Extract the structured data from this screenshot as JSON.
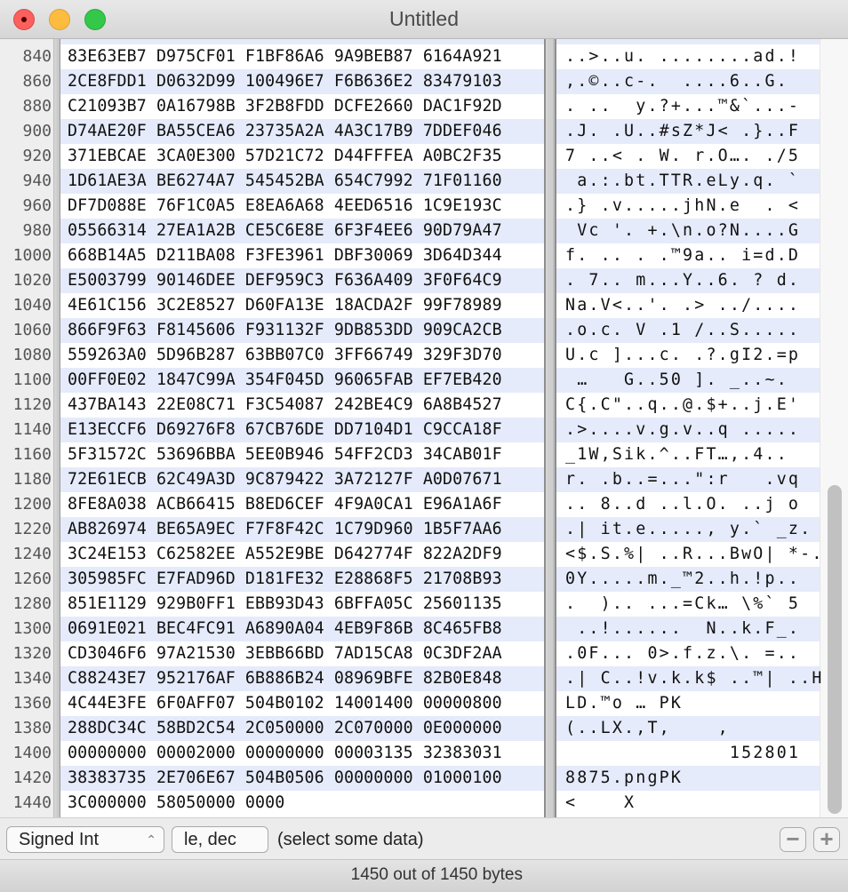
{
  "window": {
    "title": "Untitled"
  },
  "editor": {
    "partial_top_ascii": "y",
    "rows": [
      {
        "offset": "840",
        "hex": "83E63EB7 D975CF01 F1BF86A6 9A9BEB87 6164A921",
        "ascii": "..>..u. ........ad.!"
      },
      {
        "offset": "860",
        "hex": "2CE8FDD1 D0632D99 100496E7 F6B636E2 83479103",
        "ascii": ",.©..c-.  ....6..G."
      },
      {
        "offset": "880",
        "hex": "C21093B7 0A16798B 3F2B8FDD DCFE2660 DAC1F92D",
        "ascii": ". ..  y.?+...™&`...-"
      },
      {
        "offset": "900",
        "hex": "D74AE20F BA55CEA6 23735A2A 4A3C17B9 7DDEF046",
        "ascii": ".J. .U..#sZ*J< .}..F"
      },
      {
        "offset": "920",
        "hex": "371EBCAE 3CA0E300 57D21C72 D44FFFEA A0BC2F35",
        "ascii": "7 ..< . W. r.O…. ./5"
      },
      {
        "offset": "940",
        "hex": "1D61AE3A BE6274A7 545452BA 654C7992 71F01160",
        "ascii": " a.:.bt.TTR.eLy.q. `"
      },
      {
        "offset": "960",
        "hex": "DF7D088E 76F1C0A5 E8EA6A68 4EED6516 1C9E193C",
        "ascii": ".} .v.....jhN.e  . <"
      },
      {
        "offset": "980",
        "hex": "05566314 27EA1A2B CE5C6E8E 6F3F4EE6 90D79A47",
        "ascii": " Vc '. +.\\n.o?N....G"
      },
      {
        "offset": "1000",
        "hex": "668B14A5 D211BA08 F3FE3961 DBF30069 3D64D344",
        "ascii": "f. .. . .™9a.. i=d.D"
      },
      {
        "offset": "1020",
        "hex": "E5003799 90146DEE DEF959C3 F636A409 3F0F64C9",
        "ascii": ". 7.. m...Y..6. ? d."
      },
      {
        "offset": "1040",
        "hex": "4E61C156 3C2E8527 D60FA13E 18ACDA2F 99F78989",
        "ascii": "Na.V<..'. .> ../...."
      },
      {
        "offset": "1060",
        "hex": "866F9F63 F8145606 F931132F 9DB853DD 909CA2CB",
        "ascii": ".o.c. V .1 /..S....."
      },
      {
        "offset": "1080",
        "hex": "559263A0 5D96B287 63BB07C0 3FF66749 329F3D70",
        "ascii": "U.c ]...c. .?.gI2.=p"
      },
      {
        "offset": "1100",
        "hex": "00FF0E02 1847C99A 354F045D 96065FAB EF7EB420",
        "ascii": " …   G..50 ]. _..~."
      },
      {
        "offset": "1120",
        "hex": "437BA143 22E08C71 F3C54087 242BE4C9 6A8B4527",
        "ascii": "C{.C\"..q..@.$+..j.E'"
      },
      {
        "offset": "1140",
        "hex": "E13ECCF6 D69276F8 67CB76DE DD7104D1 C9CCA18F",
        "ascii": ".>....v.g.v..q ....."
      },
      {
        "offset": "1160",
        "hex": "5F31572C 53696BBA 5EE0B946 54FF2CD3 34CAB01F",
        "ascii": "_1W,Sik.^..FT…,.4.."
      },
      {
        "offset": "1180",
        "hex": "72E61ECB 62C49A3D 9C879422 3A72127F A0D07671",
        "ascii": "r. .b..=...\":r   .vq"
      },
      {
        "offset": "1200",
        "hex": "8FE8A038 ACB66415 B8ED6CEF 4F9A0CA1 E96A1A6F",
        "ascii": ".. 8..d ..l.O. ..j o"
      },
      {
        "offset": "1220",
        "hex": "AB826974 BE65A9EC F7F8F42C 1C79D960 1B5F7AA6",
        "ascii": ".| it.e....., y.` _z."
      },
      {
        "offset": "1240",
        "hex": "3C24E153 C62582EE A552E9BE D642774F 822A2DF9",
        "ascii": "<$.S.%| ..R...BwO| *-."
      },
      {
        "offset": "1260",
        "hex": "305985FC E7FAD96D D181FE32 E28868F5 21708B93",
        "ascii": "0Y.....m._™2..h.!p.."
      },
      {
        "offset": "1280",
        "hex": "851E1129 929B0FF1 EBB93D43 6BFFA05C 25601135",
        "ascii": ".  ).. ...=Ck… \\%` 5"
      },
      {
        "offset": "1300",
        "hex": "0691E021 BEC4FC91 A6890A04 4EB9F86B 8C465FB8",
        "ascii": " ..!......  N..k.F_."
      },
      {
        "offset": "1320",
        "hex": "CD3046F6 97A21530 3EBB66BD 7AD15CA8 0C3DF2AA",
        "ascii": ".0F... 0>.f.z.\\. =.."
      },
      {
        "offset": "1340",
        "hex": "C88243E7 952176AF 6B886B24 08969BFE 82B0E848",
        "ascii": ".| C..!v.k.k$ ..™| ..H"
      },
      {
        "offset": "1360",
        "hex": "4C44E3FE 6F0AFF07 504B0102 14001400 00000800",
        "ascii": "LD.™o … PK"
      },
      {
        "offset": "1380",
        "hex": "288DC34C 58BD2C54 2C050000 2C070000 0E000000",
        "ascii": "(..LX.,T,    ,"
      },
      {
        "offset": "1400",
        "hex": "00000000 00002000 00000000 00003135 32383031",
        "ascii": "              152801"
      },
      {
        "offset": "1420",
        "hex": "38383735 2E706E67 504B0506 00000000 01000100",
        "ascii": "8875.pngPK"
      },
      {
        "offset": "1440",
        "hex": "3C000000 58050000 0000",
        "ascii": "<    X"
      }
    ],
    "scroll_position": 1.0
  },
  "footer": {
    "type_select": {
      "value": "Signed Int",
      "icon": "up-down-chevron-icon"
    },
    "format_button": "le, dec",
    "hint": "(select some data)",
    "minus_label": "−",
    "plus_label": "+"
  },
  "status": {
    "text": "1450 out of 1450 bytes"
  }
}
